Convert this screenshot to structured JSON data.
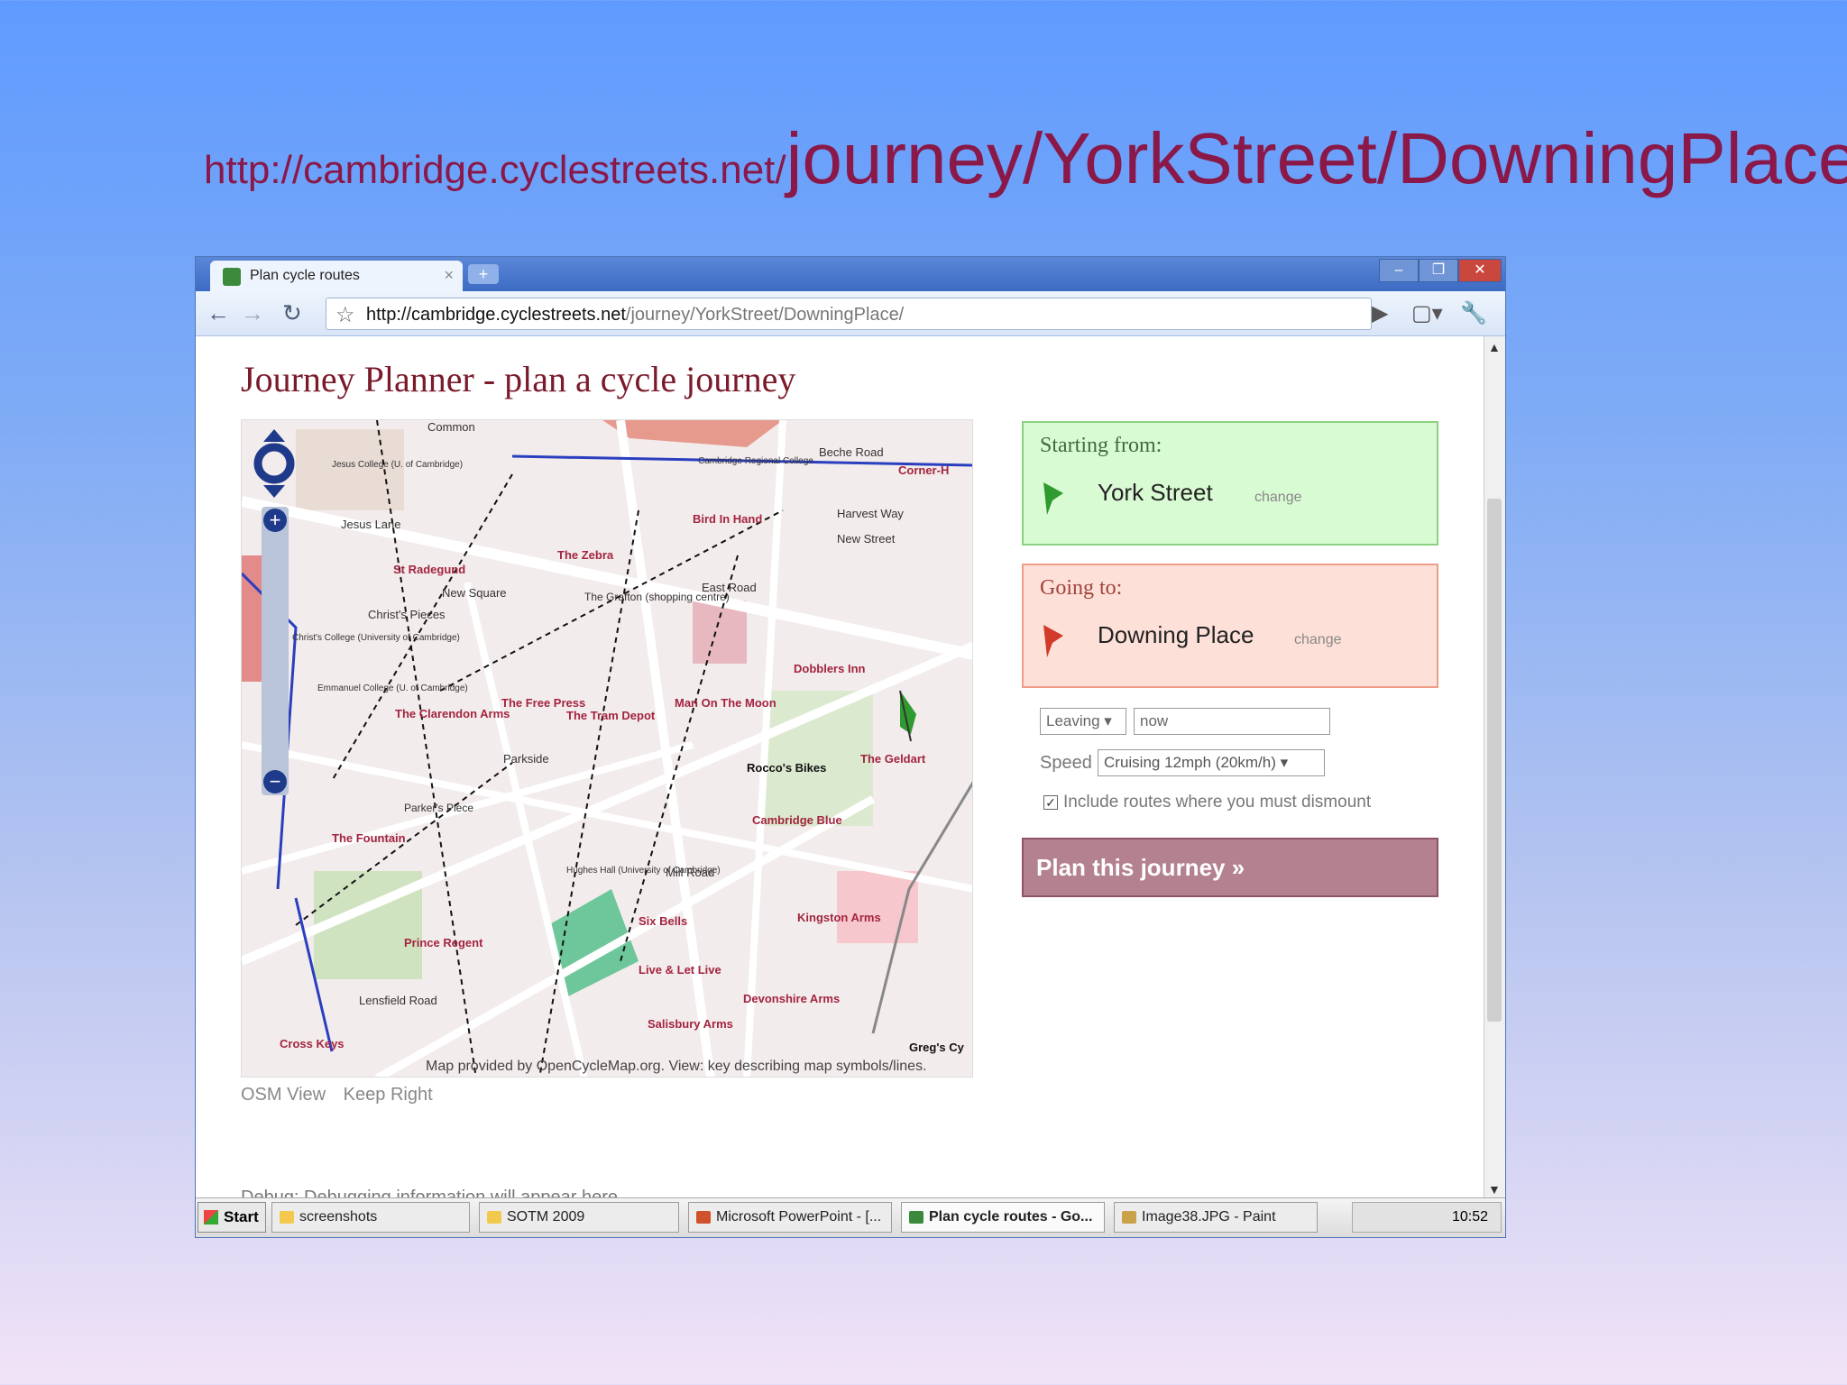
{
  "slide": {
    "url_prefix": "http://cambridge.cyclestreets.net/",
    "url_suffix": "journey/YorkStreet/DowningPlace/"
  },
  "browser": {
    "tab_title": "Plan cycle routes",
    "tab_close": "×",
    "new_tab": "+",
    "url_host": "http://cambridge.cyclestreets.net",
    "url_path": "/journey/YorkStreet/DowningPlace/",
    "minimize": "–",
    "restore": "❐",
    "close": "✕"
  },
  "page": {
    "heading": "Journey Planner - plan a cycle journey",
    "map_credit": "Map provided by OpenCycleMap.org. View: key describing map symbols/lines.",
    "map_links": [
      "OSM View",
      "Keep Right"
    ],
    "debug_text": "Debug: Debugging information will appear here"
  },
  "map_labels": [
    "Common",
    "Jesus College (U. of Cambridge)",
    "Jesus Lane",
    "St Radegund",
    "The Zebra",
    "Cambridge Regional College",
    "Bird In Hand",
    "Harvest Way",
    "New Street",
    "Corner-H",
    "Beche Road",
    "New Square",
    "Christ's Pieces",
    "The Grafton (shopping centre)",
    "East Road",
    "Christ's College (University of Cambridge)",
    "Emmanuel College (U. of Cambridge)",
    "The Clarendon Arms",
    "The Free Press",
    "The Tram Depot",
    "Man On The Moon",
    "Dobblers Inn",
    "Rocco's Bikes",
    "The Geldart",
    "Cambridge Blue",
    "The Fountain",
    "Parker's Piece",
    "Hughes Hall (University of Cambridge)",
    "Six Bells",
    "Kingston Arms",
    "Prince Regent",
    "Live & Let Live",
    "Devonshire Arms",
    "Salisbury Arms",
    "Cross Keys",
    "Lensfield Road",
    "Mill Road",
    "Parkside",
    "Greg's Cy"
  ],
  "journey": {
    "start_label": "Starting from:",
    "start_place": "York Street",
    "end_label": "Going to:",
    "end_place": "Downing Place",
    "change_label": "change",
    "leaving_option": "Leaving",
    "when_value": "now",
    "speed_label": "Speed",
    "speed_value": "Cruising 12mph (20km/h)",
    "dismount_label": "Include routes where you must dismount",
    "dismount_checked": true,
    "plan_button": "Plan this journey »"
  },
  "taskbar": {
    "start": "Start",
    "tasks": [
      "screenshots",
      "SOTM 2009",
      "Microsoft PowerPoint - [...",
      "Plan cycle routes - Go...",
      "Image38.JPG - Paint"
    ],
    "clock": "10:52"
  },
  "colors": {
    "title": "#8a1848",
    "start_panel": "#d9fbd3",
    "end_panel": "#fde0d8",
    "plan_button": "#b3818f"
  }
}
